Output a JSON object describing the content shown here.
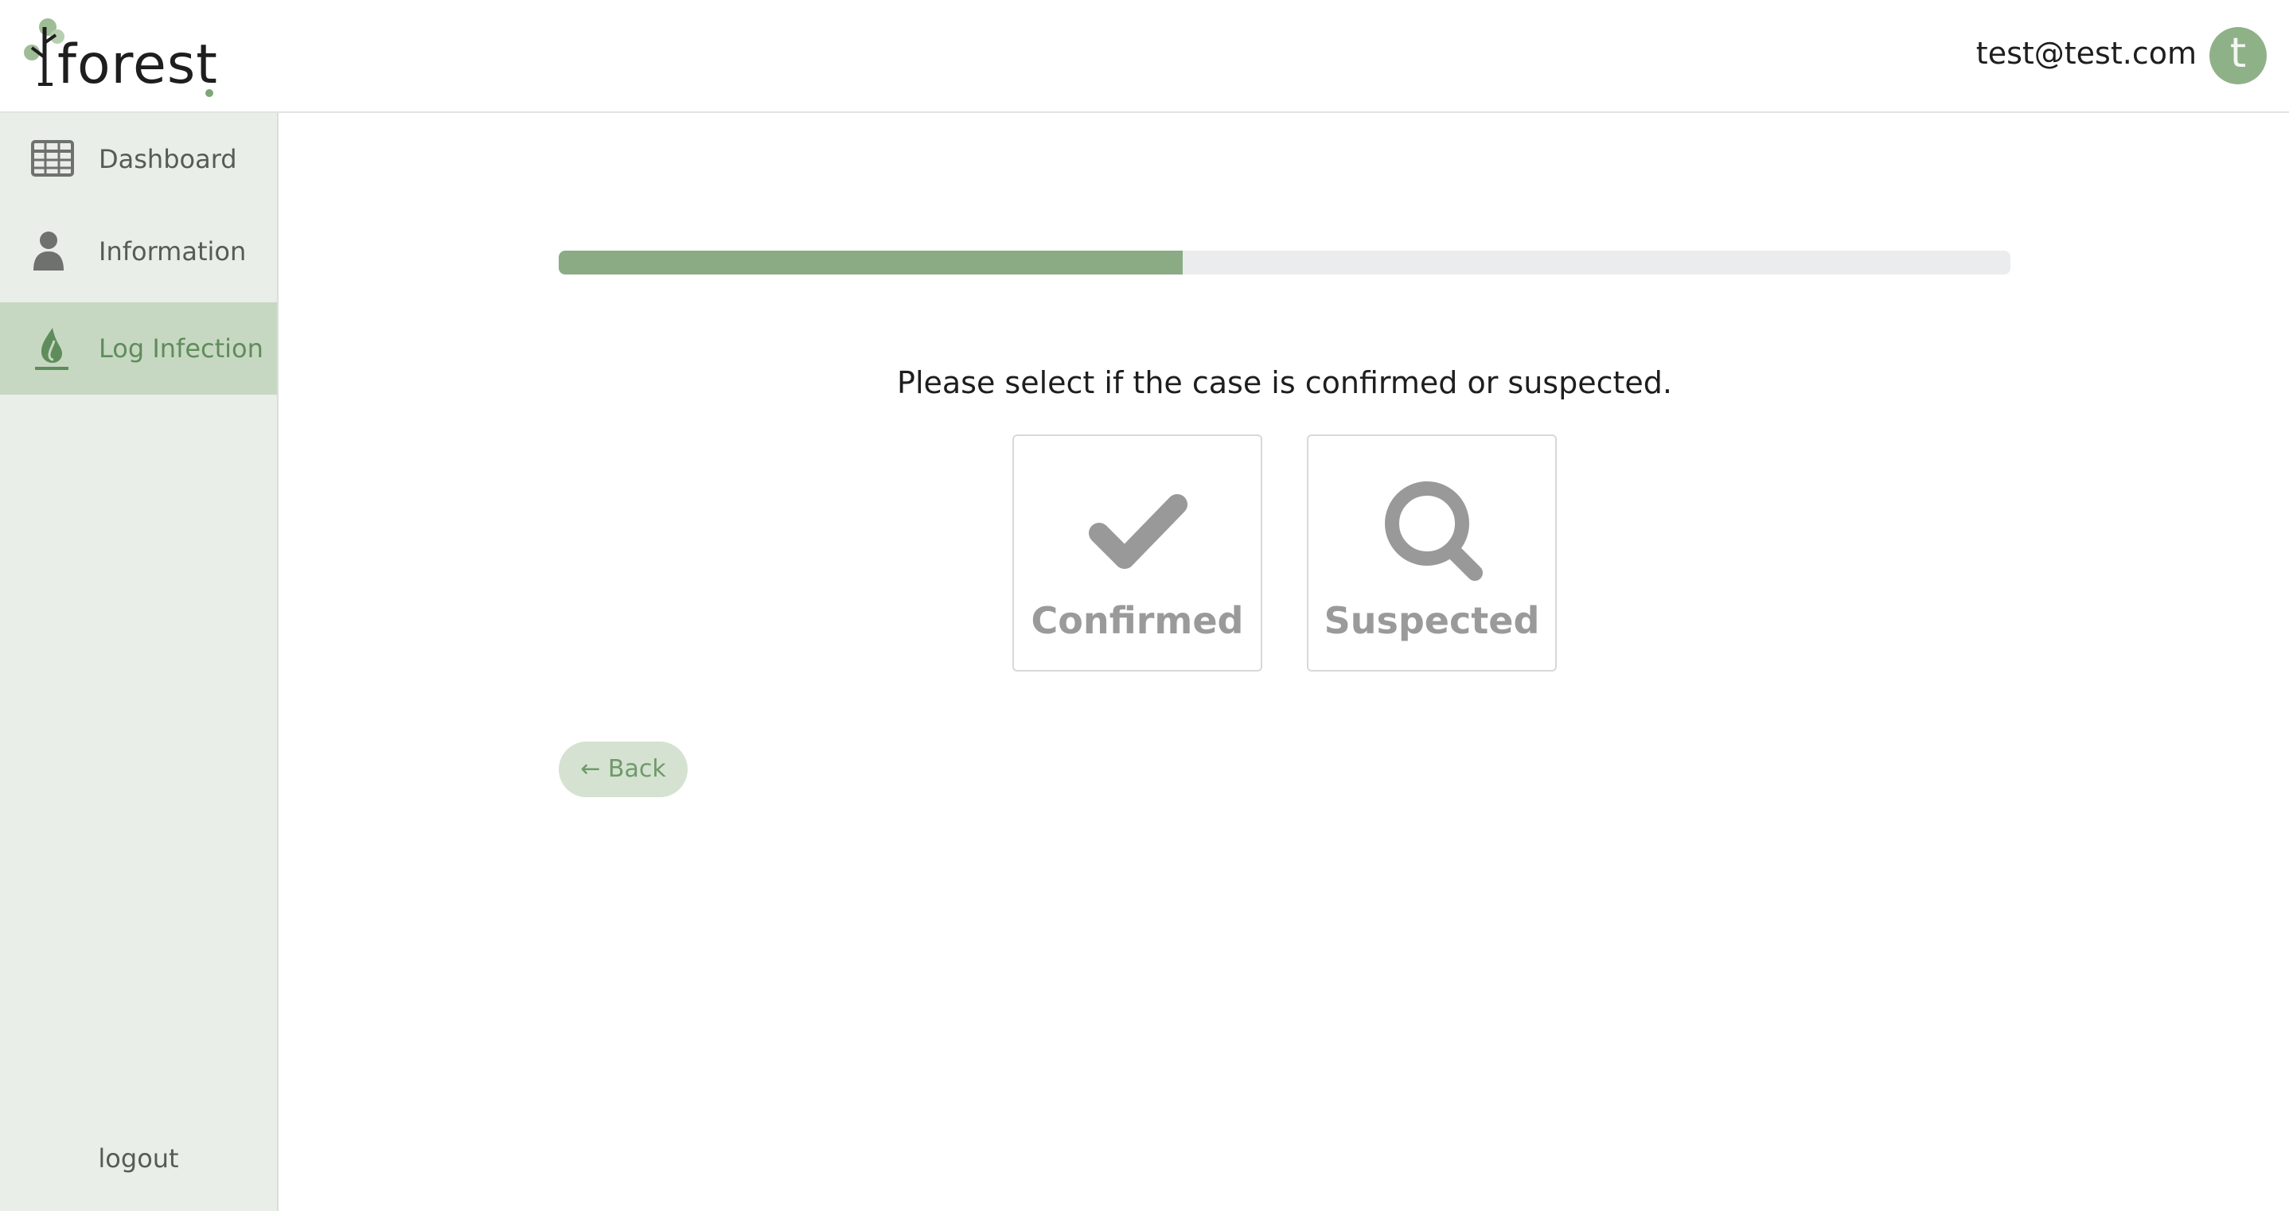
{
  "header": {
    "logo_text": "forest",
    "user_email": "test@test.com",
    "avatar_initial": "t"
  },
  "sidebar": {
    "items": [
      {
        "label": "Dashboard",
        "icon": "table-grid-icon",
        "active": false
      },
      {
        "label": "Information",
        "icon": "person-icon",
        "active": false
      },
      {
        "label": "Log Infection",
        "icon": "flame-icon",
        "active": true
      }
    ],
    "logout_label": "logout"
  },
  "main": {
    "progress": 0.43,
    "question": "Please select if the case is confirmed or suspected.",
    "choices": [
      {
        "label": "Confirmed",
        "icon": "checkmark-icon"
      },
      {
        "label": "Suspected",
        "icon": "magnifier-icon"
      }
    ],
    "back_label": "← Back"
  },
  "colors": {
    "accent": "#8aab84",
    "sidebar_bg": "#e9eee8",
    "sidebar_active_bg": "#c6d8c2",
    "card_text": "#9a9a9a",
    "avatar_bg": "#8fb188"
  }
}
